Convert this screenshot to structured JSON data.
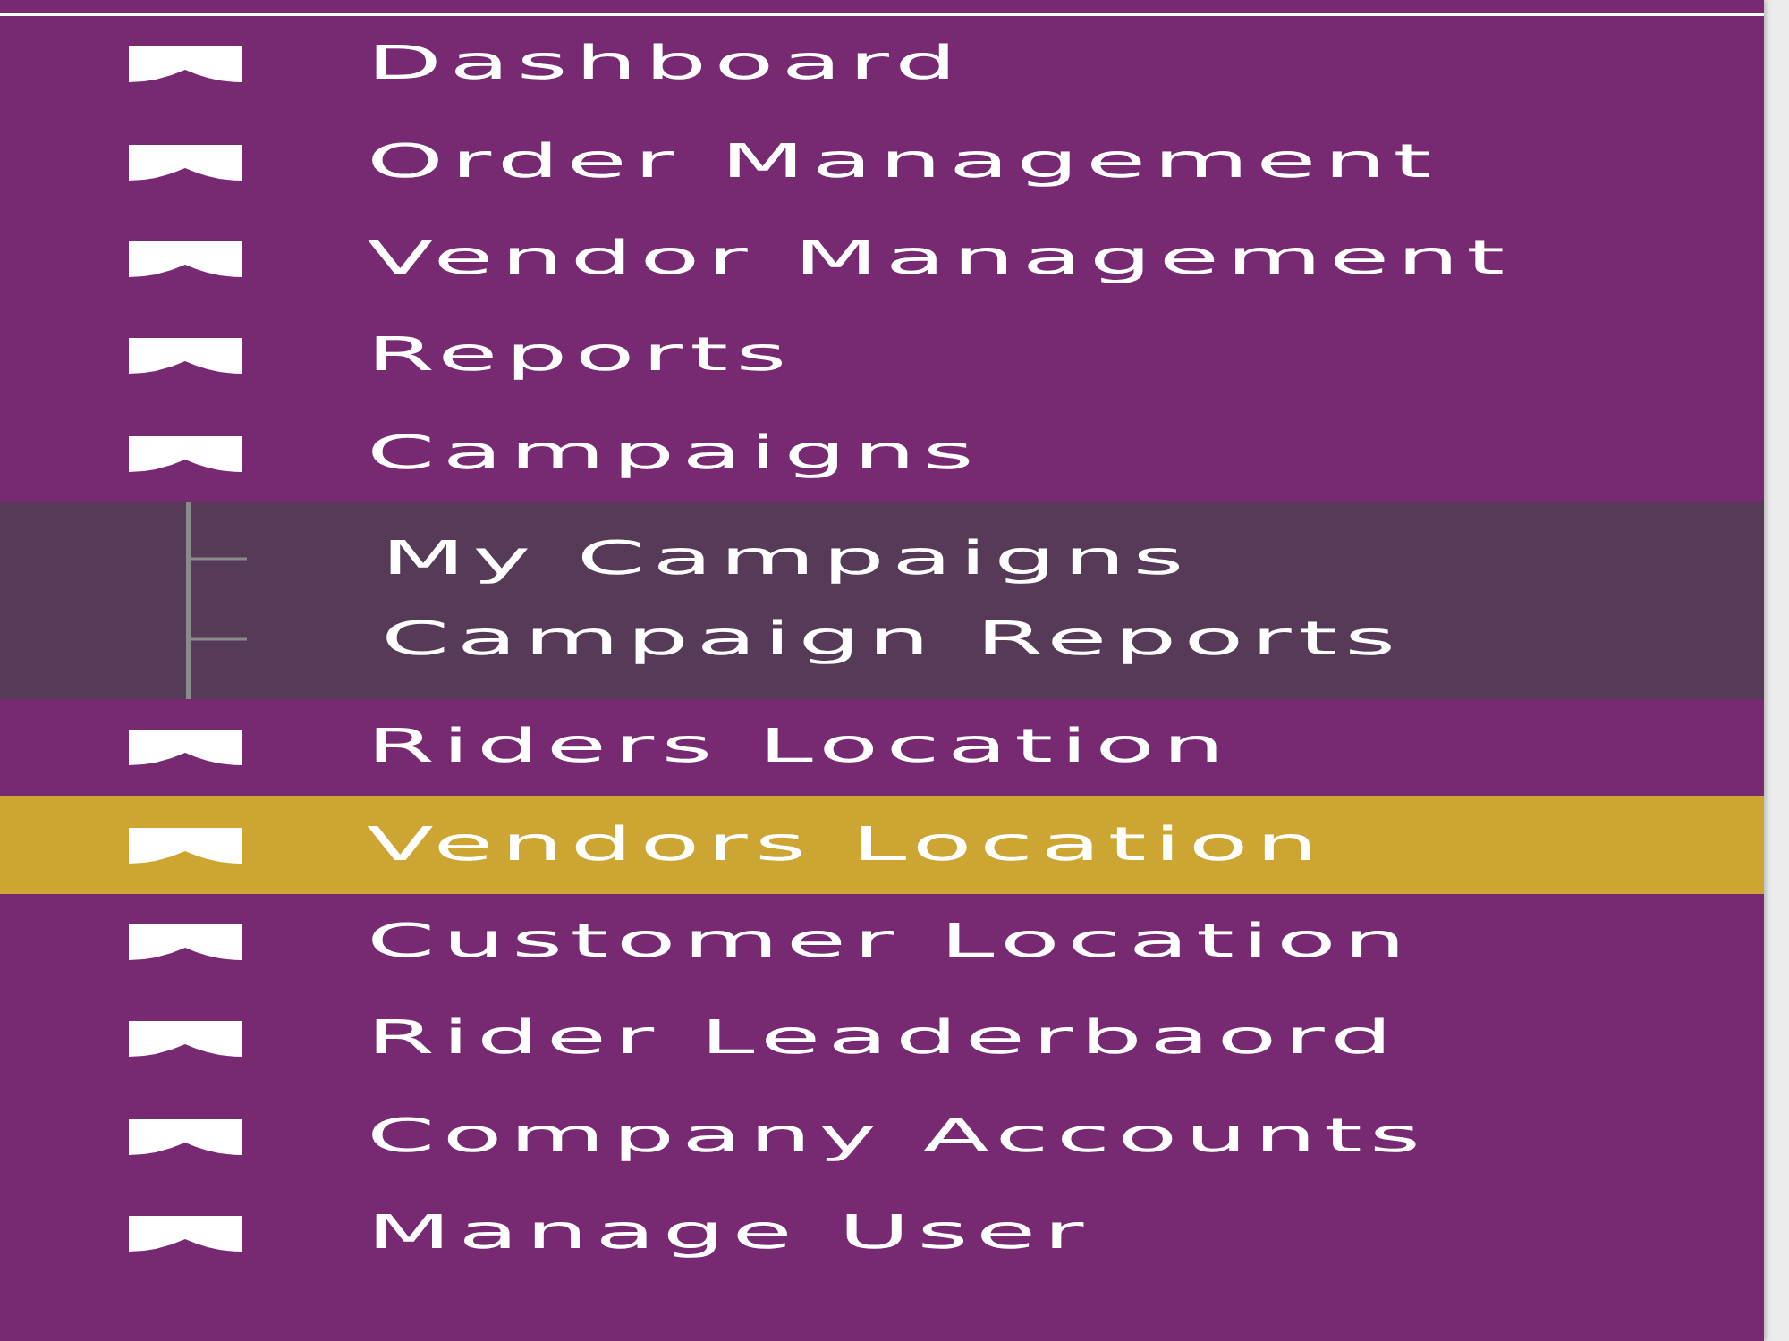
{
  "sidebar": {
    "items": [
      {
        "label": "Dashboard",
        "selected": false
      },
      {
        "label": "Order Management",
        "selected": false
      },
      {
        "label": "Vendor Management",
        "selected": false
      },
      {
        "label": "Reports",
        "selected": false
      },
      {
        "label": "Campaigns",
        "selected": false,
        "expanded": true,
        "children": [
          {
            "label": "My Campaigns",
            "selected": false
          },
          {
            "label": "Campaign Reports",
            "selected": false
          }
        ]
      },
      {
        "label": "Riders Location",
        "selected": false
      },
      {
        "label": "Vendors Location",
        "selected": true
      },
      {
        "label": "Customer Location",
        "selected": false
      },
      {
        "label": "Rider Leaderbaord",
        "selected": false
      },
      {
        "label": "Company Accounts",
        "selected": false
      },
      {
        "label": "Manage User",
        "selected": false
      }
    ]
  }
}
